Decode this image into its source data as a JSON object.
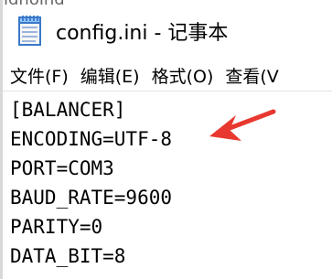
{
  "window": {
    "title": "config.ini - 记事本",
    "top_cut_text": "lgnoing"
  },
  "menu": {
    "items": [
      {
        "label": "文件(F)"
      },
      {
        "label": "编辑(E)"
      },
      {
        "label": "格式(O)"
      },
      {
        "label": "查看(V"
      }
    ]
  },
  "editor": {
    "lines": [
      "[BALANCER]",
      "ENCODING=UTF-8",
      "PORT=COM3",
      "BAUD_RATE=9600",
      "PARITY=0",
      "DATA_BIT=8"
    ]
  },
  "colors": {
    "annotation_arrow": "#e8382f"
  },
  "icons": {
    "app": "notepad-icon",
    "annotation": "red-arrow-icon"
  }
}
